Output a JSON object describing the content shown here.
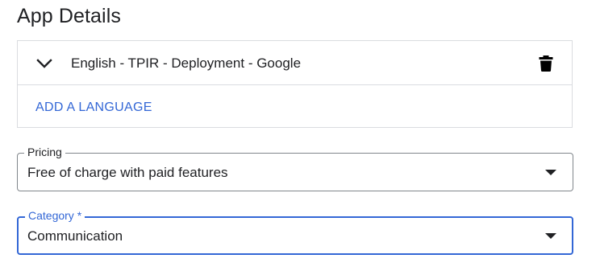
{
  "page": {
    "title": "App Details"
  },
  "languages": {
    "items": [
      {
        "label": "English - TPIR - Deployment - Google",
        "icon": "chevron-down-icon",
        "action_icon": "trash-icon"
      }
    ],
    "add_label": "ADD A LANGUAGE"
  },
  "pricing": {
    "label": "Pricing",
    "value": "Free of charge with paid features"
  },
  "category": {
    "label": "Category *",
    "value": "Communication",
    "focused": true
  },
  "colors": {
    "accent": "#3367d6",
    "text": "#202124",
    "border": "#dadce0",
    "outline": "#80868b"
  }
}
